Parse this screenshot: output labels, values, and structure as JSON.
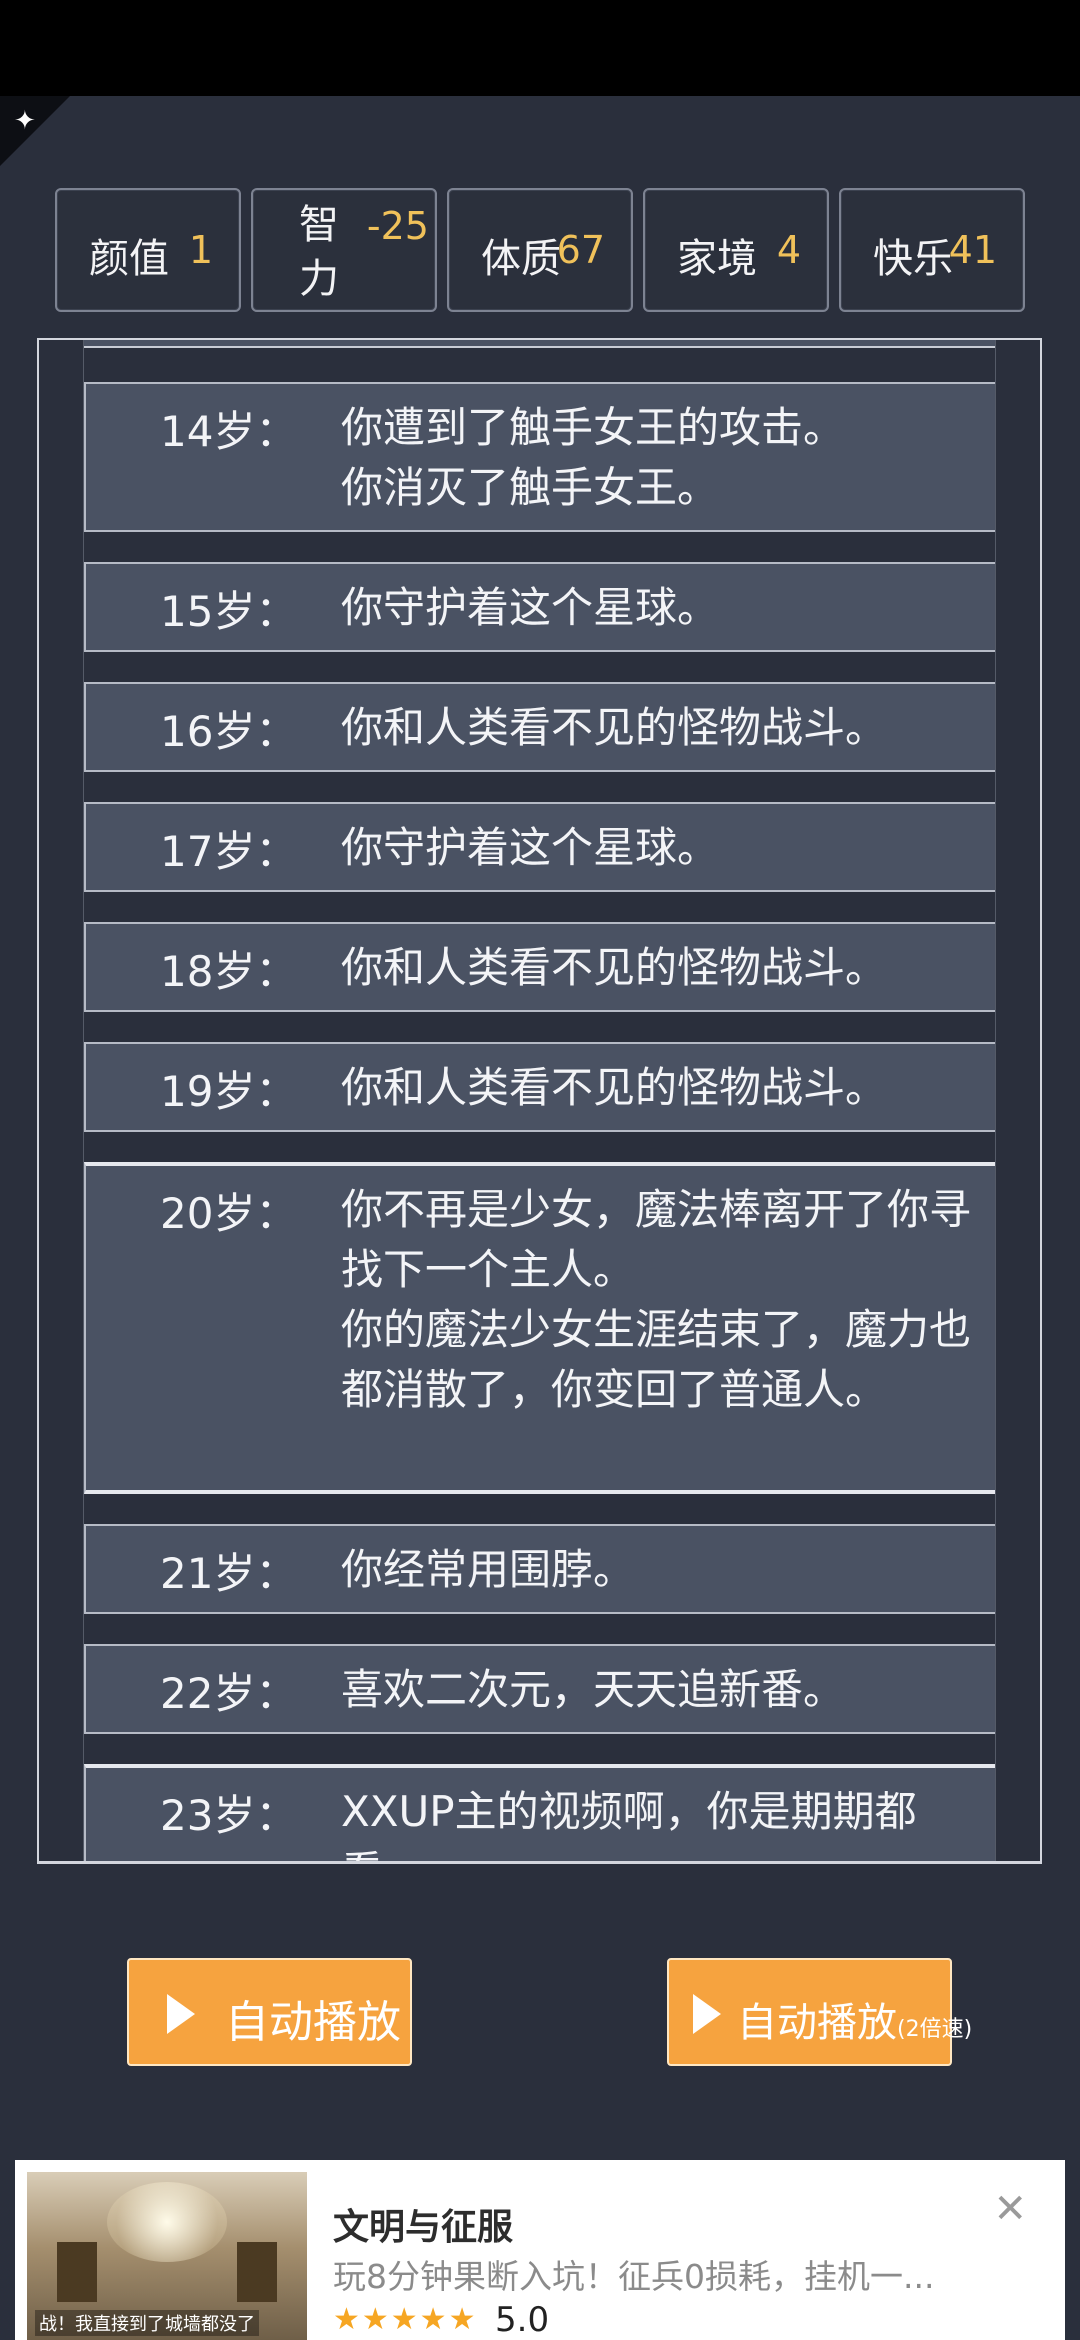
{
  "stats": [
    {
      "label": "颜值",
      "value": "1"
    },
    {
      "label": "智力",
      "value": "-25"
    },
    {
      "label": "体质",
      "value": "67"
    },
    {
      "label": "家境",
      "value": "4"
    },
    {
      "label": "快乐",
      "value": "41"
    }
  ],
  "log": [
    {
      "age": "14岁：",
      "lines": [
        "你遭到了触手女王的攻击。",
        "你消灭了触手女王。"
      ]
    },
    {
      "age": "15岁：",
      "lines": [
        "你守护着这个星球。"
      ]
    },
    {
      "age": "16岁：",
      "lines": [
        "你和人类看不见的怪物战斗。"
      ]
    },
    {
      "age": "17岁：",
      "lines": [
        "你守护着这个星球。"
      ]
    },
    {
      "age": "18岁：",
      "lines": [
        "你和人类看不见的怪物战斗。"
      ]
    },
    {
      "age": "19岁：",
      "lines": [
        "你和人类看不见的怪物战斗。"
      ]
    },
    {
      "age": "20岁：",
      "lines": [
        "你不再是少女，魔法棒离开了你寻找下一个主人。",
        "你的魔法少女生涯结束了，魔力也都消散了，你变回了普通人。"
      ]
    },
    {
      "age": "21岁：",
      "lines": [
        "你经常用围脖。"
      ]
    },
    {
      "age": "22岁：",
      "lines": [
        "喜欢二次元，天天追新番。"
      ]
    },
    {
      "age": "23岁：",
      "lines": [
        "XXUP主的视频啊，你是期期都看。"
      ]
    }
  ],
  "buttons": {
    "autoplay": "自动播放",
    "autoplay2x": "自动播放",
    "autoplay2x_sub": "(2倍速)"
  },
  "ad": {
    "title": "文明与征服",
    "description": "玩8分钟果断入坑！征兵0损耗，挂机一...",
    "stars": "★★★★★",
    "rating": "5.0",
    "close": "✕",
    "thumb_caption": "战！我直接到了城墙都没了"
  }
}
